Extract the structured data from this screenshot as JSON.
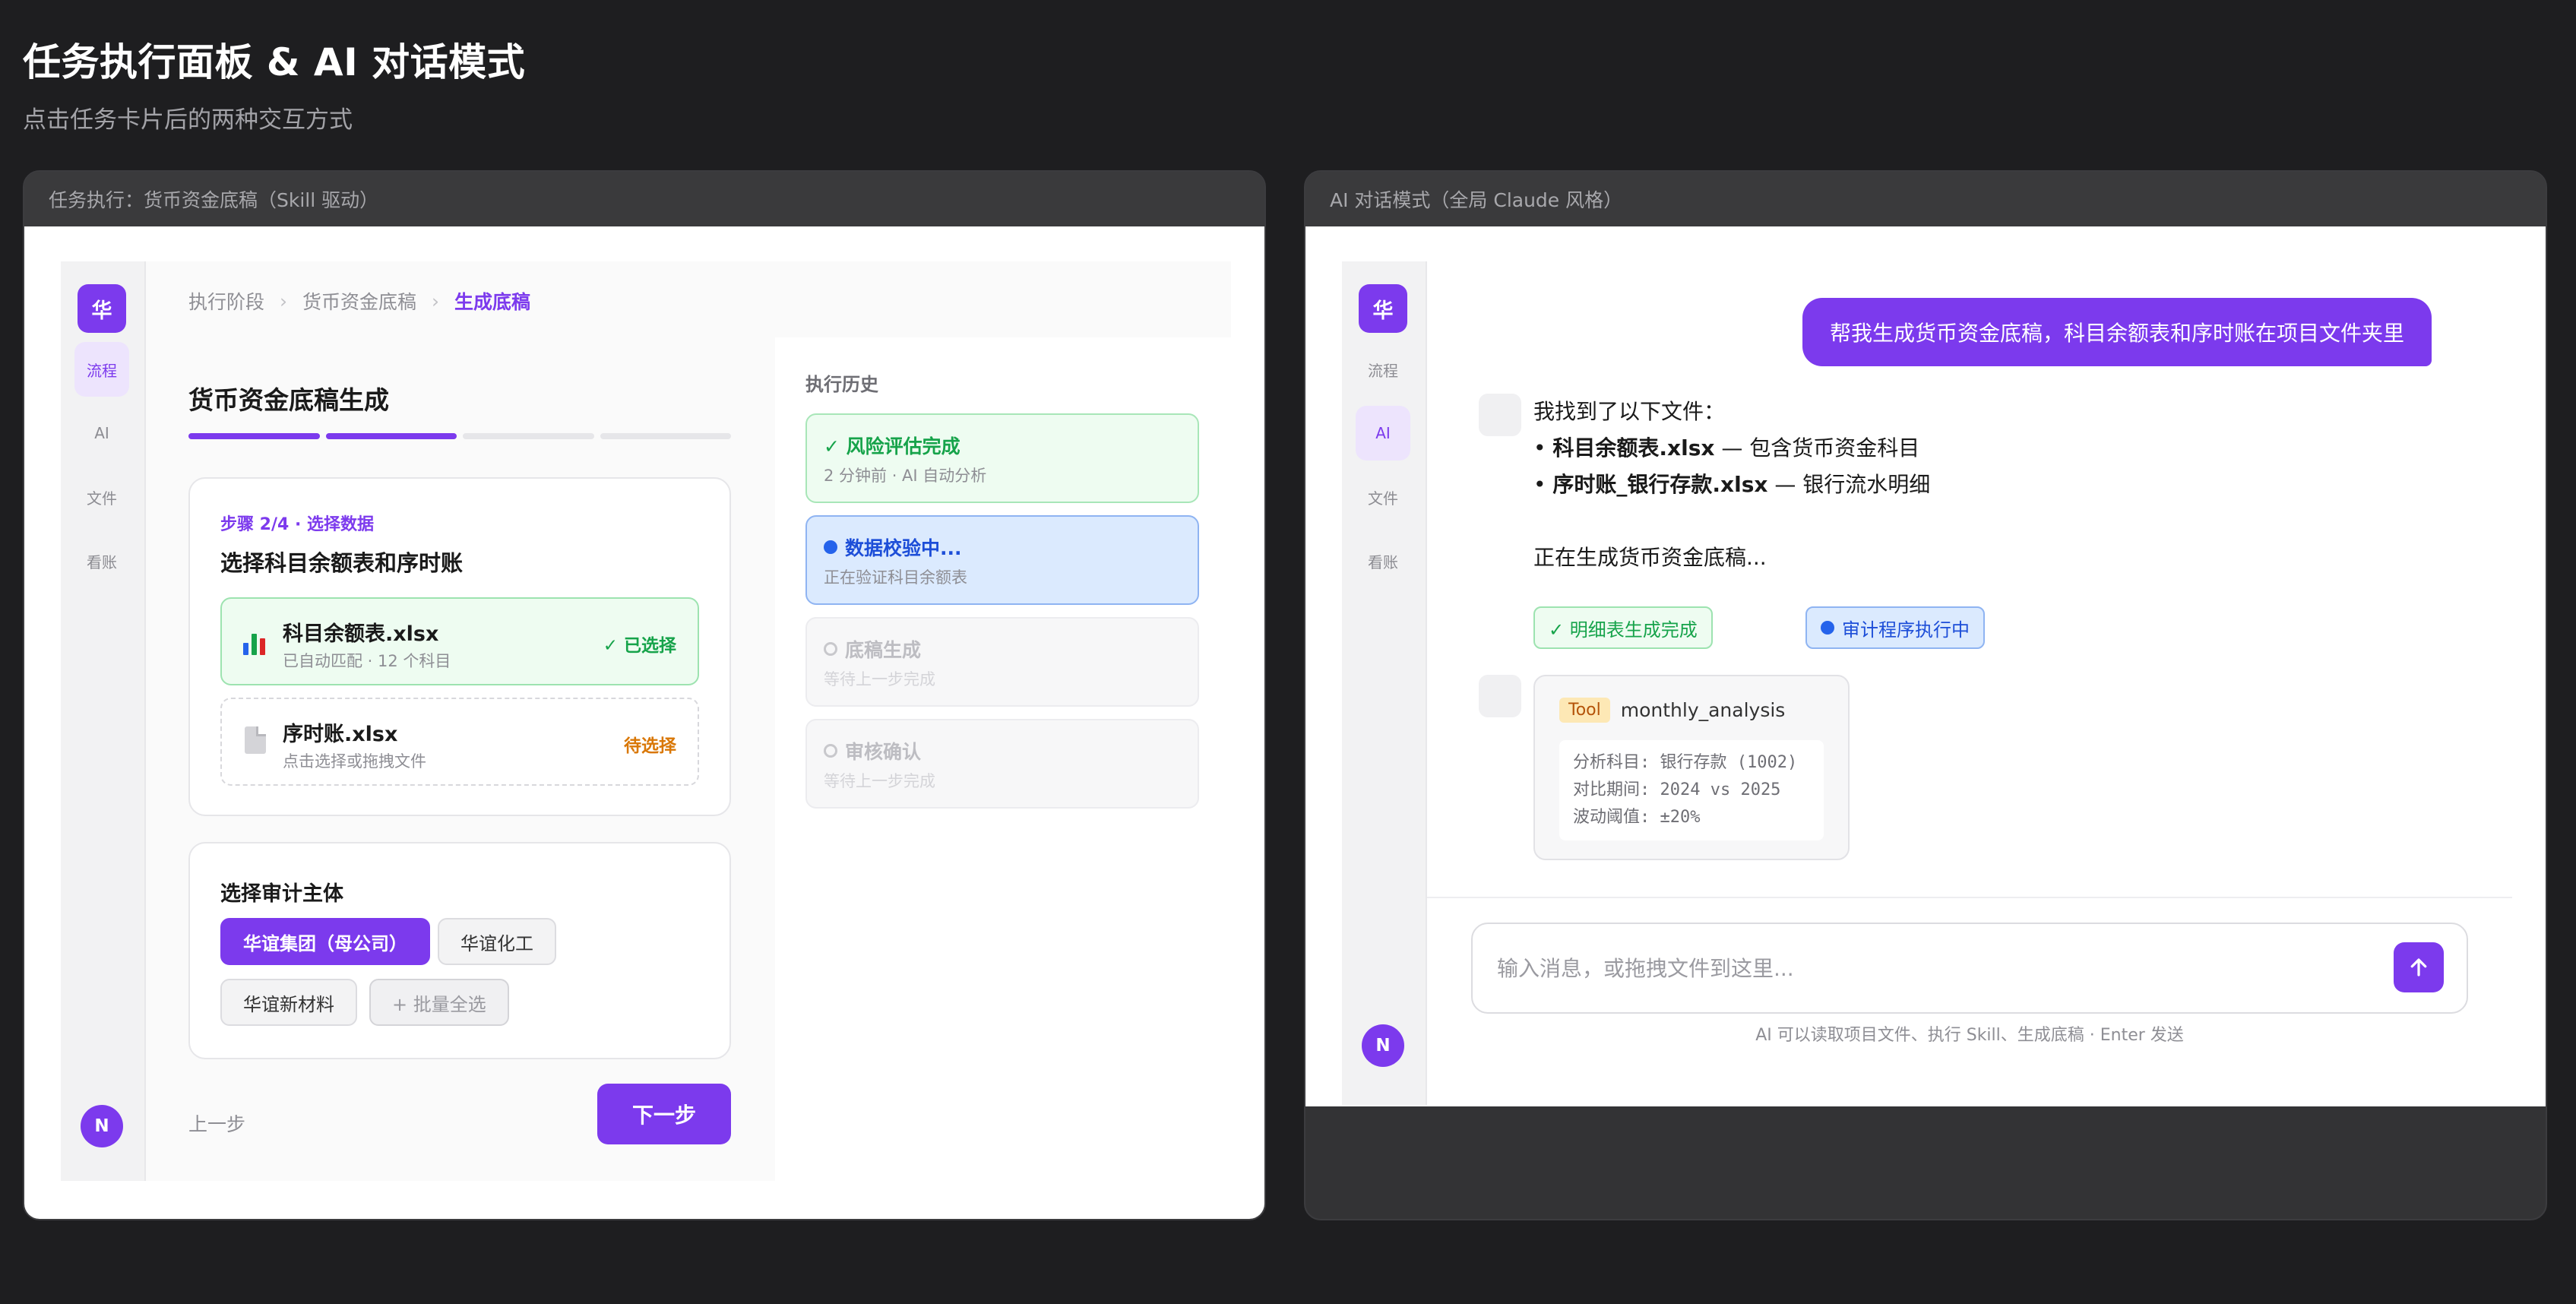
{
  "page": {
    "title": "任务执行面板 & AI 对话模式",
    "subtitle": "点击任务卡片后的两种交互方式"
  },
  "colors": {
    "accent": "#7c3aed",
    "success": "#16a34a",
    "running": "#2563eb",
    "warning": "#d97706"
  },
  "left_window": {
    "title": "任务执行：货币资金底稿（Skill 驱动）",
    "rail": {
      "logo": "华",
      "items": [
        "流程",
        "AI",
        "文件",
        "看账"
      ],
      "avatar": "N"
    },
    "breadcrumb": [
      "执行阶段",
      "货币资金底稿",
      "生成底稿"
    ],
    "task": {
      "title": "货币资金底稿生成",
      "progress": {
        "steps_total": 4,
        "steps_done": 2
      },
      "step_label": "步骤 2/4 · 选择数据",
      "step_title": "选择科目余额表和序时账",
      "files": [
        {
          "icon": "spreadsheet-icon",
          "name": "科目余额表.xlsx",
          "sub": "已自动匹配 · 12 个科目",
          "status": "✓ 已选择"
        },
        {
          "icon": "document-icon",
          "name": "序时账.xlsx",
          "sub": "点击选择或拖拽文件",
          "status": "待选择"
        }
      ],
      "entity_title": "选择审计主体",
      "entities": [
        "华谊集团（母公司）",
        "华谊化工",
        "华谊新材料",
        "+ 批量全选"
      ],
      "prev_label": "上一步",
      "next_label": "下一步"
    },
    "history": {
      "title": "执行历史",
      "items": [
        {
          "name": "✓ 风险评估完成",
          "sub": "2 分钟前 · AI 自动分析"
        },
        {
          "name": "数据校验中...",
          "sub": "正在验证科目余额表"
        },
        {
          "name": "底稿生成",
          "sub": "等待上一步完成"
        },
        {
          "name": "审核确认",
          "sub": "等待上一步完成"
        }
      ]
    }
  },
  "right_window": {
    "title": "AI 对话模式（全局 Claude 风格）",
    "rail": {
      "logo": "华",
      "items": [
        "流程",
        "AI",
        "文件",
        "看账"
      ],
      "avatar": "N"
    },
    "user_message": "帮我生成货币资金底稿，科目余额表和序时账在项目文件夹里",
    "ai_reply": {
      "intro": "我找到了以下文件：",
      "files": [
        {
          "name": "科目余额表.xlsx",
          "desc": "— 包含货币资金科目"
        },
        {
          "name": "序时账_银行存款.xlsx",
          "desc": "— 银行流水明细"
        }
      ],
      "status": "正在生成货币资金底稿..."
    },
    "tags": [
      "✓ 明细表生成完成",
      "审计程序执行中"
    ],
    "tool": {
      "badge": "Tool",
      "name": "monthly_analysis",
      "params": [
        "分析科目: 银行存款 (1002)",
        "对比期间: 2024 vs 2025",
        "波动阈值: ±20%"
      ]
    },
    "composer": {
      "placeholder": "输入消息，或拖拽文件到这里...",
      "hint": "AI 可以读取项目文件、执行 Skill、生成底稿 · Enter 发送"
    }
  }
}
